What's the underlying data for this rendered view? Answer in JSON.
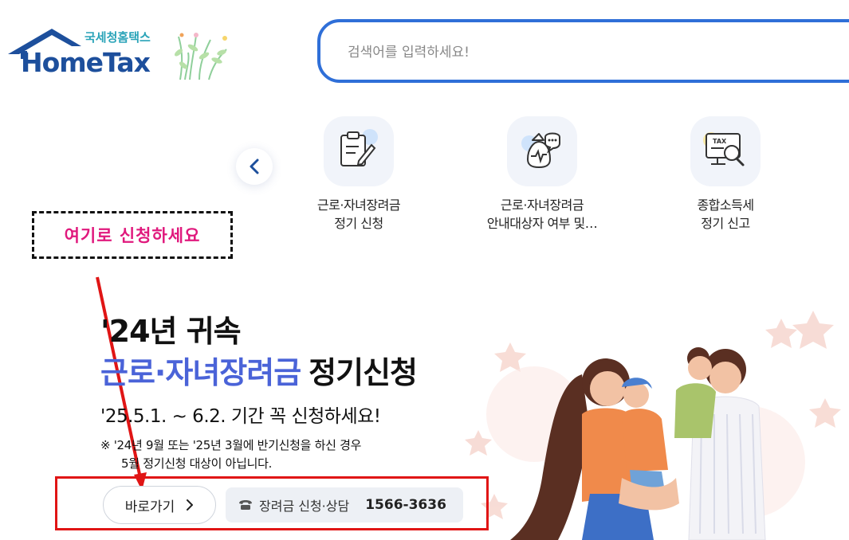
{
  "logo": {
    "korean": "국세청홈택스",
    "english": "HomeTax"
  },
  "search": {
    "placeholder": "검색어를 입력하세요!"
  },
  "quick_menu": {
    "prev_icon": "chevron-left-icon",
    "items": [
      {
        "label": "근로·자녀장려금\n정기 신청",
        "icon": "clipboard-pen-icon"
      },
      {
        "label": "근로·자녀장려금\n안내대상자 여부 및…",
        "icon": "money-bag-chat-icon"
      },
      {
        "label": "종합소득세\n정기 신고",
        "icon": "tax-monitor-search-icon"
      }
    ]
  },
  "annotation": {
    "text": "여기로 신청하세요"
  },
  "banner": {
    "title_line1": "'24년 귀속",
    "title_highlight": "근로·자녀장려금",
    "title_rest": "정기신청",
    "period": "'25.5.1. ~ 6.2. 기간 꼭 신청하세요!",
    "note_line1": "※ '24년 9월 또는 '25년 3월에 반기신청을 하신 경우",
    "note_line2": "5월 정기신청 대상이 아닙니다.",
    "go_button": "바로가기",
    "phone_label": "장려금 신청·상담",
    "phone_number": "1566-3636"
  },
  "colors": {
    "brand_blue": "#1d4f9c",
    "search_border": "#2f6fd8",
    "highlight_blue": "#4a63d8",
    "annotation_pink": "#e0197d",
    "annotation_red": "#e01515"
  }
}
